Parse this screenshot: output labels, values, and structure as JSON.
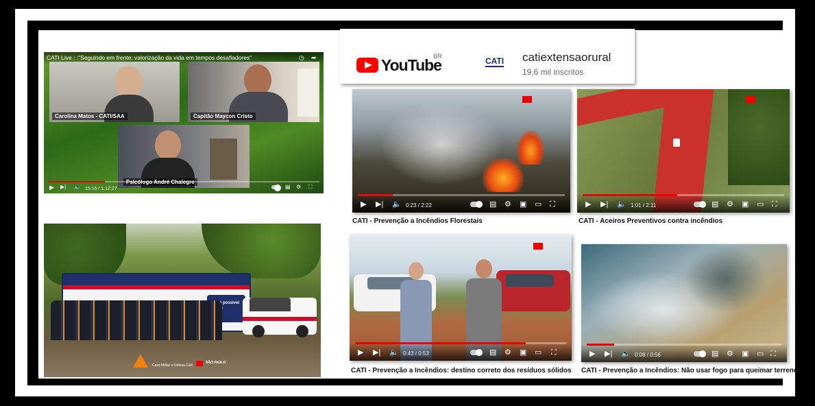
{
  "live": {
    "title": "CATI Live : :\"Seguindo em frente: valorização da vida em tempos desafiadores\"",
    "participants": [
      "Carolina Matos - CATI/SAA",
      "Capitão Maycon Cristo",
      "Psicólogo André Chalegre"
    ],
    "time": "15:15 / 1:12:27"
  },
  "event_photo": {
    "bus_text": "Crer é possível vencer",
    "footer": "Casa Militar e Defesa Civil",
    "state": "SÃO PAULO"
  },
  "channel": {
    "brand": "YouTube",
    "region": "BR",
    "logo_text": "CATI",
    "name": "catiextensaorural",
    "subscribers": "19,6 mil inscritos"
  },
  "videos": [
    {
      "title": "CATI - Prevenção a Incêndios Florestais",
      "time": "0:23 / 2:22",
      "progress": 0.17
    },
    {
      "title": "CATI - Aceiros Preventivos contra incêndios",
      "time": "1:01 / 2:11",
      "progress": 0.47
    },
    {
      "title": "CATI - Prevenção a Incêndios: destino correto dos resíduos sólidos",
      "time": "0:43 / 0:53",
      "progress": 0.81
    },
    {
      "title": "CATI - Prevenção a Incêndios: Não usar fogo para queimar terreno.",
      "time": "0:08 / 0:56",
      "progress": 0.14
    }
  ],
  "colors": {
    "accent": "#ff0000",
    "progress": "#e00000"
  }
}
